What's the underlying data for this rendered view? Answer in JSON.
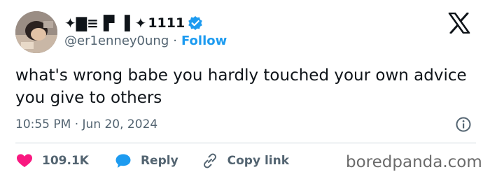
{
  "author": {
    "display_name_glyphs": "✦▇≡ ▛ ▐ ✦",
    "display_name_tail": "1111",
    "handle": "@er1enney0ung",
    "separator": "·",
    "follow_label": "Follow",
    "verified_icon": "verified-badge-icon"
  },
  "platform_logo": "x-logo-icon",
  "tweet": {
    "text": "what's wrong babe you hardly touched your own advice you give to others",
    "timestamp": "10:55 PM · Jun 20, 2024"
  },
  "actions": {
    "like_count": "109.1K",
    "reply_label": "Reply",
    "copy_label": "Copy link"
  },
  "watermark": "boredpanda.com",
  "colors": {
    "accent": "#1d9bf0",
    "like": "#f91880",
    "text": "#0f1419",
    "muted": "#536471",
    "divider": "#cfd9de"
  }
}
